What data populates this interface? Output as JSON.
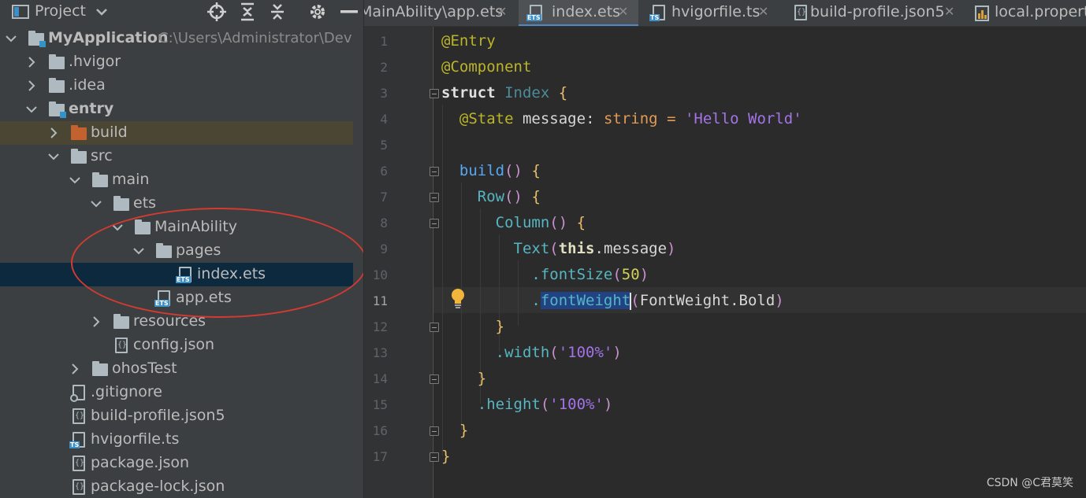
{
  "project_panel": {
    "title": "Project",
    "tree": [
      {
        "label": "MyApplication",
        "path": "C:\\Users\\Administrator\\DevEco"
      },
      {
        "label": ".hvigor"
      },
      {
        "label": ".idea"
      },
      {
        "label": "entry"
      },
      {
        "label": "build"
      },
      {
        "label": "src"
      },
      {
        "label": "main"
      },
      {
        "label": "ets"
      },
      {
        "label": "MainAbility"
      },
      {
        "label": "pages"
      },
      {
        "label": "index.ets"
      },
      {
        "label": "app.ets"
      },
      {
        "label": "resources"
      },
      {
        "label": "config.json"
      },
      {
        "label": "ohosTest"
      },
      {
        "label": ".gitignore"
      },
      {
        "label": "build-profile.json5"
      },
      {
        "label": "hvigorfile.ts"
      },
      {
        "label": "package.json"
      },
      {
        "label": "package-lock.json"
      }
    ]
  },
  "tabs": [
    {
      "label": "MainAbility\\app.ets"
    },
    {
      "label": "index.ets",
      "active": true
    },
    {
      "label": "hvigorfile.ts"
    },
    {
      "label": "build-profile.json5"
    },
    {
      "label": "local.properties"
    }
  ],
  "editor": {
    "current_line": 11,
    "line_numbers": [
      "1",
      "2",
      "3",
      "4",
      "5",
      "6",
      "7",
      "8",
      "9",
      "10",
      "11",
      "12",
      "13",
      "14",
      "15",
      "16",
      "17"
    ],
    "code": {
      "entry": "@Entry",
      "component": "@Component",
      "struct_kw": "struct",
      "struct_name": "Index",
      "state_ann": "@State",
      "message_decl": "message",
      "string_type": "string",
      "hello_str": "'Hello World'",
      "build_fn": "build",
      "row_fn": "Row",
      "column_fn": "Column",
      "text_fn": "Text",
      "this_kw": "this",
      "message_ref": ".message",
      "font_size_fn": ".fontSize",
      "font_size_val": "50",
      "font_weight_fn": "fontWeight",
      "font_weight_arg": "FontWeight.Bold",
      "width_fn": ".width",
      "width_val": "'100%'",
      "height_fn": ".height",
      "height_val": "'100%'"
    }
  },
  "watermark": "CSDN @C君莫笑",
  "colors": {
    "annotation_circle": "#d33a32",
    "active_tab_underline": "#4a88c7",
    "selection": "#214283"
  }
}
